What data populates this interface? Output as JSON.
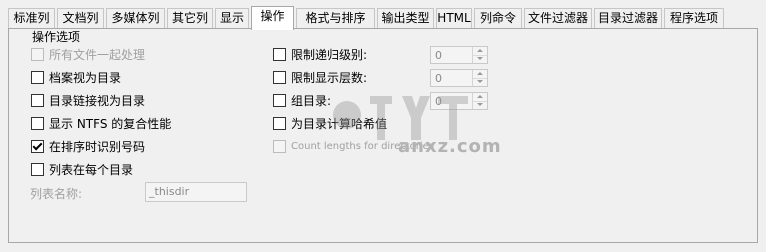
{
  "tabs": [
    "标准列",
    "文档列",
    "多媒体列",
    "其它列",
    "显示",
    "操作",
    "格式与排序",
    "输出类型",
    "HTML",
    "列命令",
    "文件过滤器",
    "目录过滤器",
    "程序选项"
  ],
  "active_tab": "操作",
  "group_title": "操作选项",
  "left_options": [
    {
      "label": "所有文件一起处理",
      "checked": false,
      "disabled": true
    },
    {
      "label": "档案视为目录",
      "checked": false,
      "disabled": false
    },
    {
      "label": "目录链接视为目录",
      "checked": false,
      "disabled": false
    },
    {
      "label": "显示 NTFS 的复合性能",
      "checked": false,
      "disabled": false
    },
    {
      "label": "在排序时识别号码",
      "checked": true,
      "disabled": false
    },
    {
      "label": "列表在每个目录",
      "checked": false,
      "disabled": false
    }
  ],
  "right_options": [
    {
      "label": "限制递归级别:",
      "checked": false,
      "disabled": false,
      "spin_value": "0"
    },
    {
      "label": "限制显示层数:",
      "checked": false,
      "disabled": false,
      "spin_value": "0"
    },
    {
      "label": "组目录:",
      "checked": false,
      "disabled": false,
      "spin_value": "0"
    },
    {
      "label": "为目录计算哈希值",
      "checked": false,
      "disabled": false
    },
    {
      "label": "Count lengths for directories",
      "checked": false,
      "disabled": true
    }
  ],
  "list_name": {
    "label": "列表名称:",
    "value": "_thisdir"
  },
  "watermark": {
    "text": "anxz.com"
  },
  "colors": {
    "background": "#f0f0f0",
    "active_tab": "#ffffff",
    "border": "#a8a8a8",
    "disabled_text": "#a0a0a0"
  }
}
